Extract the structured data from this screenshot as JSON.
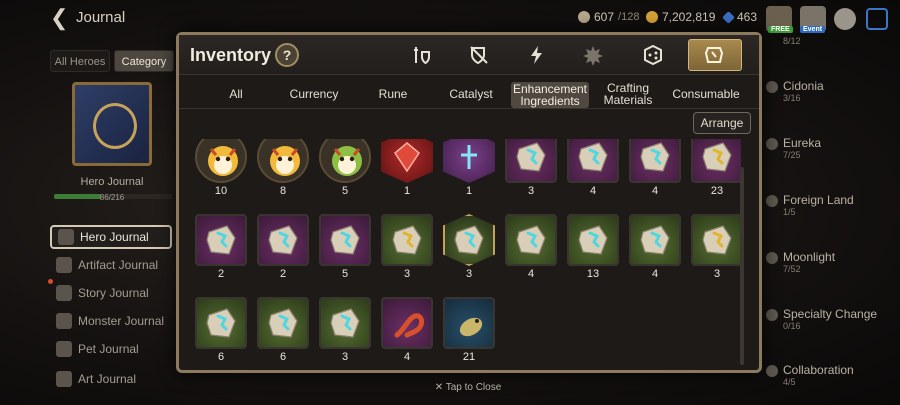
{
  "topbar": {
    "title": "Journal",
    "stamina": "607",
    "stamina_max": "/128",
    "gold": "7,202,819",
    "gems": "463",
    "free_badge": "FREE",
    "event_badge": "Event"
  },
  "left": {
    "tabs": [
      "All Heroes",
      "Category"
    ],
    "hero_journal_label": "Hero Journal",
    "hero_journal_count": "86/216",
    "hero_journal_progress": 0.398,
    "nav": [
      {
        "label": "Hero Journal",
        "icon": "hero-journal-icon",
        "active": true
      },
      {
        "label": "Artifact Journal",
        "icon": "artifact-icon",
        "active": false
      },
      {
        "label": "Story Journal",
        "icon": "story-icon",
        "active": false
      },
      {
        "label": "Monster Journal",
        "icon": "monster-icon",
        "active": false
      },
      {
        "label": "Pet Journal",
        "icon": "paw-icon",
        "active": false
      },
      {
        "label": "Art Journal",
        "icon": "art-icon",
        "active": false
      }
    ]
  },
  "right": {
    "items": [
      {
        "name": "",
        "count": "8/12"
      },
      {
        "name": "Cidonia",
        "count": "3/16"
      },
      {
        "name": "Eureka",
        "count": "7/25"
      },
      {
        "name": "Foreign Land",
        "count": "1/5"
      },
      {
        "name": "Moonlight",
        "count": "7/52"
      },
      {
        "name": "Specialty Change",
        "count": "0/16"
      },
      {
        "name": "Collaboration",
        "count": "4/5"
      }
    ]
  },
  "inventory": {
    "title": "Inventory",
    "help": "?",
    "category_icons": [
      "equipment-icon",
      "shield-sword-icon",
      "lightning-icon",
      "artifact-splat-icon",
      "cube-icon",
      "materials-icon"
    ],
    "active_category": 5,
    "subtabs": [
      "All",
      "Currency",
      "Rune",
      "Catalyst",
      "Enhancement Ingredients",
      "Crafting Materials",
      "Consumable"
    ],
    "active_subtab": 4,
    "arrange_label": "Arrange",
    "items": [
      {
        "kind": "creature",
        "qty": "10"
      },
      {
        "kind": "creature",
        "qty": "8"
      },
      {
        "kind": "creature-green",
        "qty": "5"
      },
      {
        "kind": "gem-red",
        "qty": "1"
      },
      {
        "kind": "gem-violet",
        "qty": "1"
      },
      {
        "kind": "rune-purple",
        "qty": "3"
      },
      {
        "kind": "rune-purple",
        "qty": "4"
      },
      {
        "kind": "rune-purple",
        "qty": "4"
      },
      {
        "kind": "rune-purple-gold",
        "qty": "23"
      },
      {
        "kind": "rune-purple",
        "qty": "2"
      },
      {
        "kind": "rune-purple",
        "qty": "2"
      },
      {
        "kind": "rune-purple",
        "qty": "5"
      },
      {
        "kind": "rune-green-gold",
        "qty": "3"
      },
      {
        "kind": "rune-green-hex",
        "qty": "3"
      },
      {
        "kind": "rune-green",
        "qty": "4"
      },
      {
        "kind": "rune-green",
        "qty": "13"
      },
      {
        "kind": "rune-green",
        "qty": "4"
      },
      {
        "kind": "rune-green-gold",
        "qty": "3"
      },
      {
        "kind": "rune-green",
        "qty": "6"
      },
      {
        "kind": "rune-green",
        "qty": "6"
      },
      {
        "kind": "rune-green",
        "qty": "3"
      },
      {
        "kind": "salamander",
        "qty": "4"
      },
      {
        "kind": "fish",
        "qty": "21"
      }
    ]
  },
  "footer": {
    "close_hint": "✕ Tap to Close"
  },
  "colors": {
    "accent_gold": "#c5a15a",
    "progress_green": "#3b7d34",
    "purple_bg": "#6c2f66",
    "green_bg": "#556e31"
  }
}
